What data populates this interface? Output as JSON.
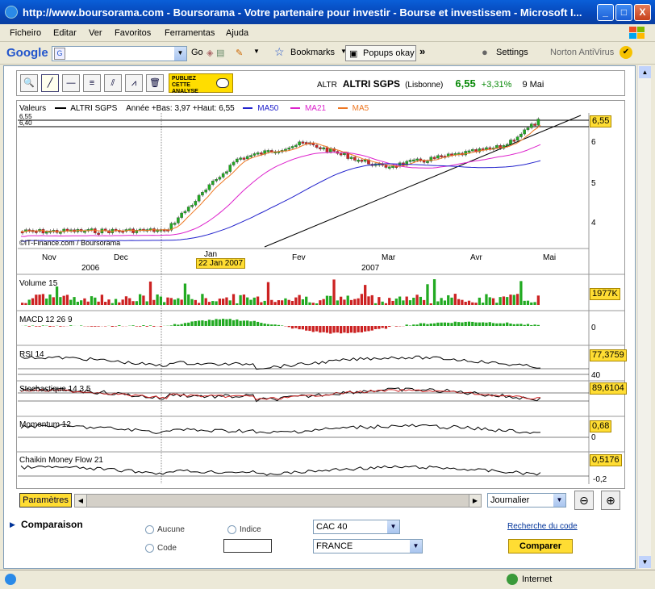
{
  "window": {
    "title": "http://www.boursorama.com - Boursorama - Votre partenaire pour investir - Bourse et investissem - Microsoft I...",
    "controls": [
      "_",
      "□",
      "X"
    ]
  },
  "menu": [
    "Ficheiro",
    "Editar",
    "Ver",
    "Favoritos",
    "Ferramentas",
    "Ajuda"
  ],
  "google_toolbar": {
    "brand": "Google",
    "go": "Go",
    "bookmarks": "Bookmarks",
    "popups": "Popups okay",
    "more": "»",
    "settings": "Settings",
    "norton": "Norton AntiVirus"
  },
  "quote": {
    "ticker": "ALTR",
    "name": "ALTRI SGPS",
    "market": "(Lisbonne)",
    "price": "6,55",
    "change": "+3,31%",
    "date": "9 Mai"
  },
  "publish_badge": {
    "line1": "PUBLIEZ",
    "line2": "CETTE",
    "line3": "ANALYSE"
  },
  "main_chart": {
    "legend": {
      "values": "Valeurs",
      "series": "ALTRI SGPS",
      "range": "Année +Bas: 3,97 +Haut: 6,55",
      "ma50": "MA50",
      "ma21": "MA21",
      "ma5": "MA5"
    },
    "top_left_ticks": [
      "6,55",
      "6,40"
    ],
    "y_ticks": [
      "6",
      "5",
      "4"
    ],
    "last_value": "6,55",
    "credit": "©IT-Finance.com / Boursorama",
    "months": [
      "Nov",
      "Dec",
      "Jan",
      "Fev",
      "Mar",
      "Avr",
      "Mai"
    ],
    "years": [
      "2006",
      "2007"
    ],
    "cursor_date": "22 Jan 2007",
    "colors": {
      "candles_up": "#22aa22",
      "candles_down": "#cc2222",
      "ma50": "#2222cc",
      "ma21": "#dd22cc",
      "ma5": "#ee7722"
    }
  },
  "panels": [
    {
      "title": "Volume 15",
      "badge": "1977K",
      "axis": ""
    },
    {
      "title": "MACD 12 26 9",
      "badge": "",
      "axis": "0"
    },
    {
      "title": "RSI 14",
      "badge": "77,3759",
      "axis": "40"
    },
    {
      "title": "Stochastique 14 3 5",
      "badge": "89,6104",
      "axis": ""
    },
    {
      "title": "Momentum 12",
      "badge": "0,68",
      "axis": "0"
    },
    {
      "title": "Chaikin Money Flow 21",
      "badge": "0,5176",
      "axis": "-0,2"
    }
  ],
  "controls": {
    "parametres": "Paramètres",
    "period": "Journalier"
  },
  "comparison": {
    "title": "Comparaison",
    "aucune": "Aucune",
    "indice": "Indice",
    "code": "Code",
    "index_select": "CAC 40",
    "country_select": "FRANCE",
    "search_link": "Recherche du code",
    "compare_button": "Comparer"
  },
  "status": {
    "zone": "Internet"
  }
}
